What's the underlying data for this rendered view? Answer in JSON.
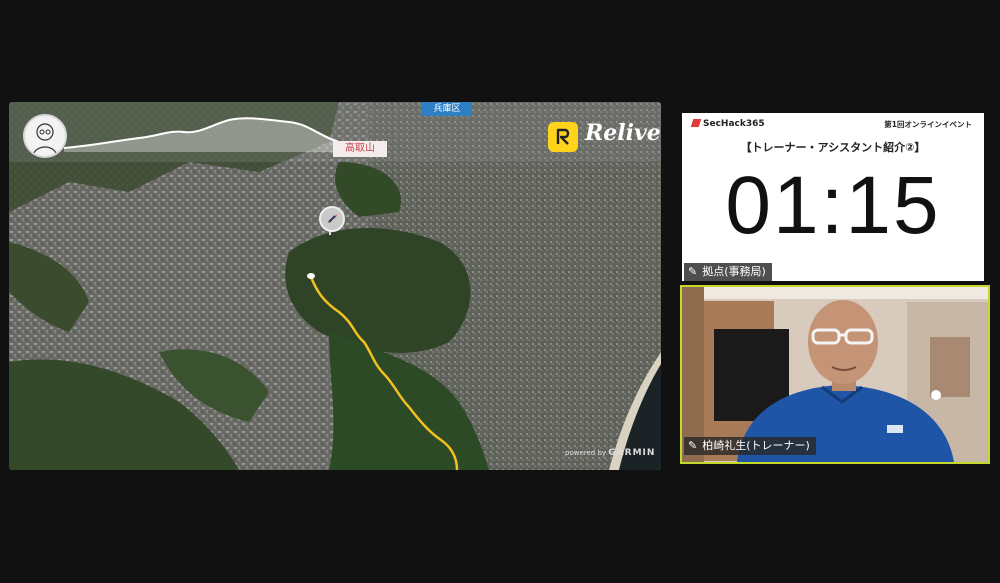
{
  "share_screen": {
    "district_label": "兵庫区",
    "peak_label": "高取山",
    "app_logo_text": "Relive",
    "attribution_small": "powered by",
    "attribution_brand": "GARMIN",
    "route_color": "#f2c01f"
  },
  "timer_panel": {
    "brand": "SecHack365",
    "event": "第1回オンラインイベント",
    "section_title": "【トレーナー・アシスタント紹介②】",
    "countdown": "01:15",
    "participant_label": "拠点(事務局)"
  },
  "camera_panel": {
    "participant_label": "柏崎礼生(トレーナー)",
    "active_speaker_color": "#c3da2c"
  },
  "icons": {
    "pin": "pin-icon",
    "relive": "relive-logo-icon",
    "rocket": "rocket-marker-icon"
  }
}
